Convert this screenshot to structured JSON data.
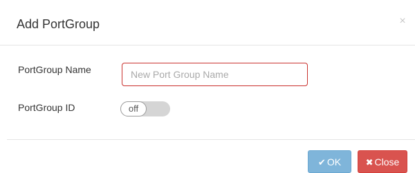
{
  "dialog": {
    "title": "Add PortGroup",
    "close_glyph": "×"
  },
  "form": {
    "name_label": "PortGroup Name",
    "name_value": "",
    "name_placeholder": "New Port Group Name",
    "id_label": "PortGroup ID",
    "id_toggle_state": "off"
  },
  "footer": {
    "ok_icon": "✔",
    "ok_label": "OK",
    "close_icon": "✖",
    "close_label": "Close"
  },
  "icons": {
    "ok": "check-icon",
    "close": "x-icon",
    "dismiss": "close-icon"
  },
  "colors": {
    "ok_button": "#7fb5da",
    "close_button": "#d9534f",
    "input_border_error": "#c9302c",
    "toggle_track": "#d5d5d5"
  }
}
